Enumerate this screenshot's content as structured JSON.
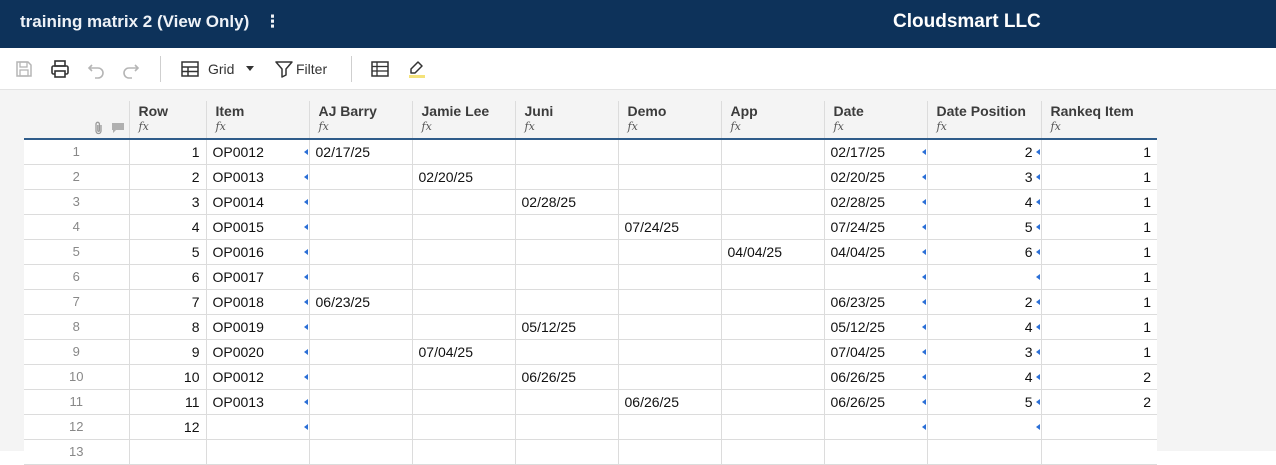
{
  "header": {
    "title": "training matrix 2 (View Only)",
    "more_glyph": "⋮",
    "company": "Cloudsmart LLC",
    "background": "#0d325a"
  },
  "toolbar": {
    "view_label": "Grid",
    "filter_label": "Filter",
    "icons": [
      "save-icon",
      "print-icon",
      "undo-icon",
      "redo-icon",
      "grid-view-icon",
      "dropdown-caret-icon",
      "filter-icon",
      "table-icon",
      "highlight-icon"
    ]
  },
  "columns": [
    {
      "label": "Row",
      "fx": "fx"
    },
    {
      "label": "Item",
      "fx": "fx"
    },
    {
      "label": "AJ Barry",
      "fx": "fx"
    },
    {
      "label": "Jamie Lee",
      "fx": "fx"
    },
    {
      "label": "Juni",
      "fx": "fx"
    },
    {
      "label": "Demo",
      "fx": "fx"
    },
    {
      "label": "App",
      "fx": "fx"
    },
    {
      "label": "Date",
      "fx": "fx"
    },
    {
      "label": "Date Position",
      "fx": "fx"
    },
    {
      "label": "Rankeq Item",
      "fx": "fx"
    }
  ],
  "rows": [
    {
      "n": "1",
      "cells": [
        "1",
        "OP0012",
        "02/17/25",
        "",
        "",
        "",
        "",
        "02/17/25",
        "2",
        "1"
      ]
    },
    {
      "n": "2",
      "cells": [
        "2",
        "OP0013",
        "",
        "02/20/25",
        "",
        "",
        "",
        "02/20/25",
        "3",
        "1"
      ]
    },
    {
      "n": "3",
      "cells": [
        "3",
        "OP0014",
        "",
        "",
        "02/28/25",
        "",
        "",
        "02/28/25",
        "4",
        "1"
      ]
    },
    {
      "n": "4",
      "cells": [
        "4",
        "OP0015",
        "",
        "",
        "",
        "07/24/25",
        "",
        "07/24/25",
        "5",
        "1"
      ]
    },
    {
      "n": "5",
      "cells": [
        "5",
        "OP0016",
        "",
        "",
        "",
        "",
        "04/04/25",
        "04/04/25",
        "6",
        "1"
      ]
    },
    {
      "n": "6",
      "cells": [
        "6",
        "OP0017",
        "",
        "",
        "",
        "",
        "",
        "",
        "",
        "1"
      ]
    },
    {
      "n": "7",
      "cells": [
        "7",
        "OP0018",
        "06/23/25",
        "",
        "",
        "",
        "",
        "06/23/25",
        "2",
        "1"
      ]
    },
    {
      "n": "8",
      "cells": [
        "8",
        "OP0019",
        "",
        "",
        "05/12/25",
        "",
        "",
        "05/12/25",
        "4",
        "1"
      ]
    },
    {
      "n": "9",
      "cells": [
        "9",
        "OP0020",
        "",
        "07/04/25",
        "",
        "",
        "",
        "07/04/25",
        "3",
        "1"
      ]
    },
    {
      "n": "10",
      "cells": [
        "10",
        "OP0012",
        "",
        "",
        "06/26/25",
        "",
        "",
        "06/26/25",
        "4",
        "2"
      ]
    },
    {
      "n": "11",
      "cells": [
        "11",
        "OP0013",
        "",
        "",
        "",
        "06/26/25",
        "",
        "06/26/25",
        "5",
        "2"
      ]
    },
    {
      "n": "12",
      "cells": [
        "12",
        "",
        "",
        "",
        "",
        "",
        "",
        "",
        "",
        ""
      ]
    },
    {
      "n": "13",
      "cells": [
        "",
        "",
        "",
        "",
        "",
        "",
        "",
        "",
        "",
        ""
      ]
    }
  ]
}
